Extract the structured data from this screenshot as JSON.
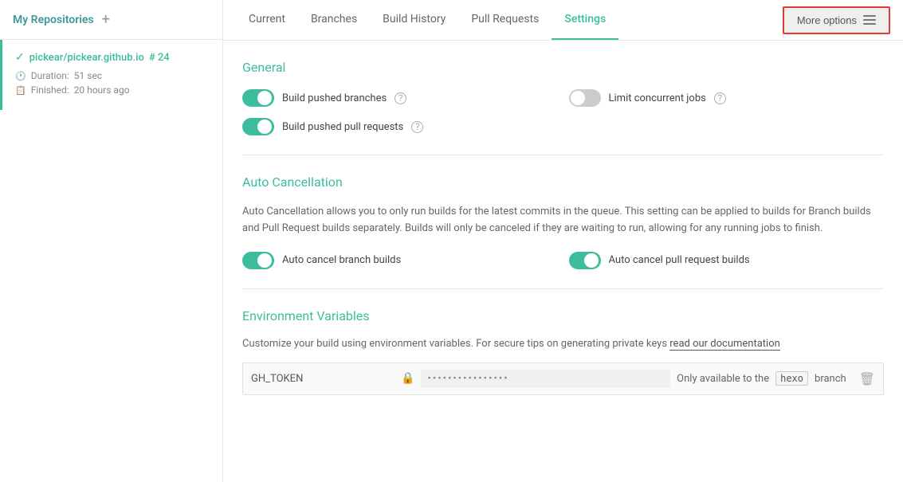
{
  "sidebar": {
    "title": "My Repositories",
    "add_label": "+",
    "repo": {
      "name": "pickear/pickear.github.io",
      "build_number": "# 24",
      "duration_label": "Duration:",
      "duration_value": "51 sec",
      "finished_label": "Finished:",
      "finished_value": "20 hours ago"
    }
  },
  "nav": {
    "tabs": [
      {
        "label": "Current",
        "active": false
      },
      {
        "label": "Branches",
        "active": false
      },
      {
        "label": "Build History",
        "active": false
      },
      {
        "label": "Pull Requests",
        "active": false
      },
      {
        "label": "Settings",
        "active": true
      }
    ],
    "more_options_label": "More options"
  },
  "content": {
    "general": {
      "title": "General",
      "toggles": [
        {
          "label": "Build pushed branches",
          "state": "on",
          "has_help": true
        },
        {
          "label": "Limit concurrent jobs",
          "state": "off",
          "has_help": true
        },
        {
          "label": "Build pushed pull requests",
          "state": "on",
          "has_help": true
        }
      ]
    },
    "auto_cancellation": {
      "title": "Auto Cancellation",
      "description": "Auto Cancellation allows you to only run builds for the latest commits in the queue. This setting can be applied to builds for Branch builds and Pull Request builds separately. Builds will only be canceled if they are waiting to run, allowing for any running jobs to finish.",
      "toggles": [
        {
          "label": "Auto cancel branch builds",
          "state": "on"
        },
        {
          "label": "Auto cancel pull request builds",
          "state": "on"
        }
      ]
    },
    "env_variables": {
      "title": "Environment Variables",
      "description": "Customize your build using environment variables. For secure tips on generating private keys",
      "link_text": "read our documentation",
      "row": {
        "key": "GH_TOKEN",
        "value": "••••••••••••••••",
        "available_text": "Only available to the",
        "branch": "hexo",
        "branch_suffix": "branch"
      }
    }
  }
}
